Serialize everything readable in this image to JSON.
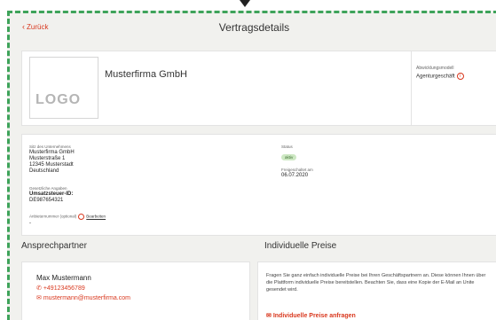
{
  "header": {
    "back_label": "Zurück",
    "title": "Vertragsdetails"
  },
  "company": {
    "logo_text": "LOGO",
    "name": "Musterfirma GmbH",
    "abwicklung_label": "Abwicklungsmodell",
    "abwicklung_value": "Agenturgeschäft"
  },
  "details": {
    "sitz_label": "Sitz des Unternehmens",
    "sitz_lines": [
      "Musterfirma GmbH",
      "Musterstraße 1",
      "12345 Musterstadt",
      "Deutschland"
    ],
    "gesetz_label": "Gesetzliche Angaben",
    "ust_label": "Umsatzsteuer-ID:",
    "ust_value": "DE987654321",
    "anbieter_label": "Anbieternummer (optional)",
    "edit_label": "Bearbeiten",
    "anbieter_value": "-",
    "status_label": "Status",
    "status_value": "aktiv",
    "freigeschaltet_label": "Freigeschaltet am",
    "freigeschaltet_value": "06.07.2020"
  },
  "contact": {
    "section_title": "Ansprechpartner",
    "name": "Max Mustermann",
    "phone": "+49123456789",
    "email": "mustermann@musterfirma.com"
  },
  "prices": {
    "section_title": "Individuelle Preise",
    "text": "Fragen Sie ganz einfach individuelle Preise bei Ihren Geschäftspartnern an. Diese können Ihnen über die Plattform individuelle Preise bereitstellen. Beachten Sie, dass eine Kopie der E-Mail an Unite gesendet wird.",
    "button_label": "Individuelle Preise anfragen"
  },
  "colors": {
    "accent": "#d9381e",
    "frame_dash": "#3ea35a",
    "status_badge_bg": "#cde8c3"
  },
  "icons": [
    "chevron-left-icon",
    "info-icon",
    "warning-icon",
    "phone-icon",
    "mail-icon"
  ]
}
